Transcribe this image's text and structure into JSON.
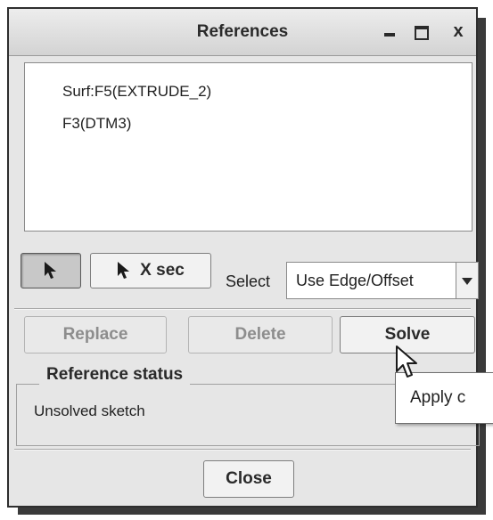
{
  "window": {
    "title": "References",
    "controls": {
      "minimize_icon": "minimize-icon",
      "maximize_icon": "maximize-icon",
      "close_glyph": "x"
    }
  },
  "references": {
    "items": [
      "Surf:F5(EXTRUDE_2)",
      "F3(DTM3)"
    ]
  },
  "toolbar": {
    "pointer_icon": "arrow-pointer-icon",
    "xsec_label": "X sec",
    "select_label": "Select",
    "select_value": "Use Edge/Offset"
  },
  "actions": {
    "replace_label": "Replace",
    "delete_label": "Delete",
    "solve_label": "Solve"
  },
  "status": {
    "group_label": "Reference status",
    "text": "Unsolved sketch"
  },
  "tooltip": {
    "text": "Apply c"
  },
  "footer": {
    "close_label": "Close"
  },
  "colors": {
    "dialog_bg": "#e6e6e6",
    "list_bg": "#ffffff",
    "border_dark": "#2e2e2e"
  }
}
